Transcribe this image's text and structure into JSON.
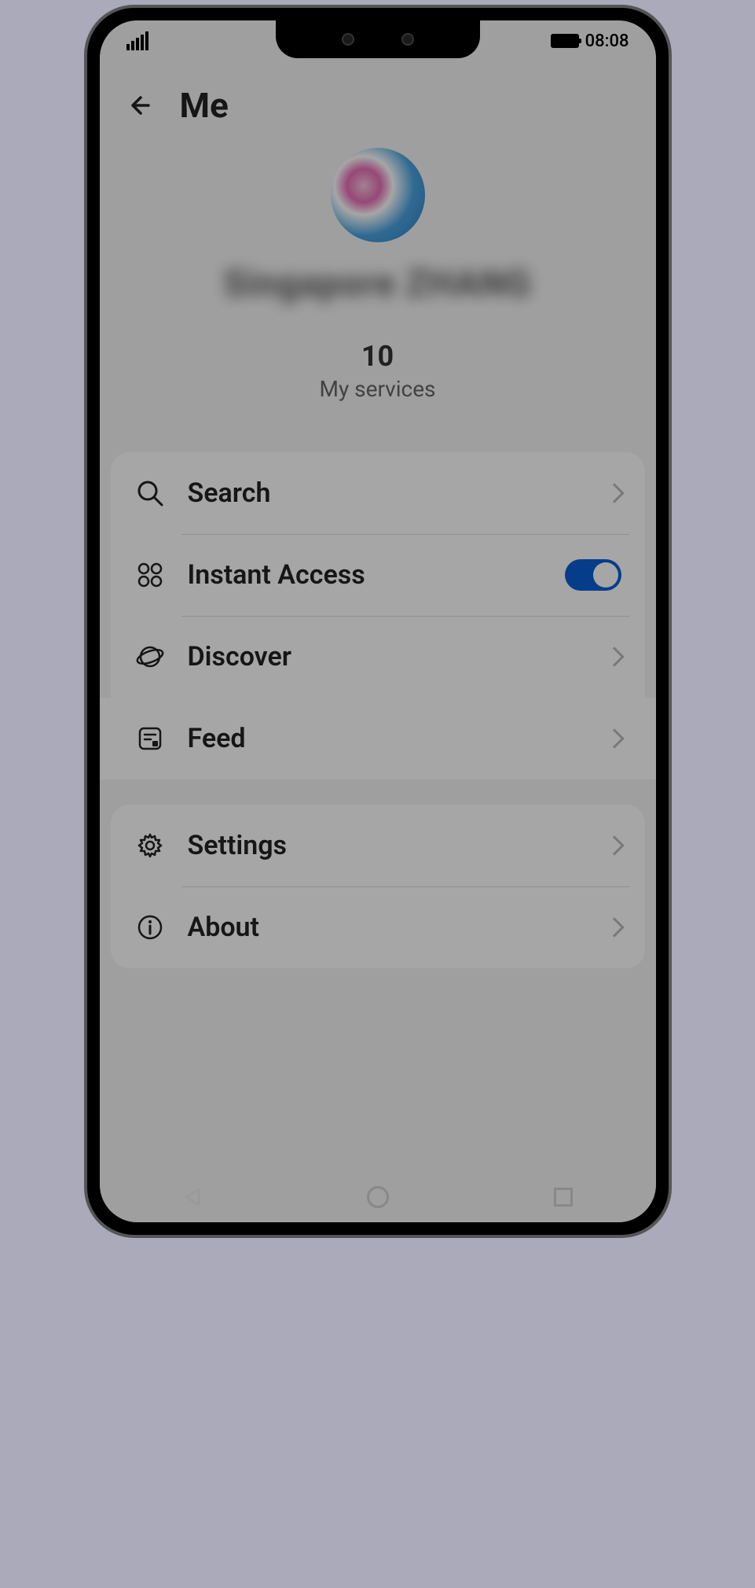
{
  "status": {
    "time": "08:08"
  },
  "header": {
    "title": "Me"
  },
  "profile": {
    "username": "Singapore ZHANG",
    "stat_count": "10",
    "stat_label": "My services"
  },
  "menu1": {
    "search": "Search",
    "instant": "Instant Access",
    "discover": "Discover",
    "feed": "Feed"
  },
  "menu2": {
    "settings": "Settings",
    "about": "About"
  }
}
